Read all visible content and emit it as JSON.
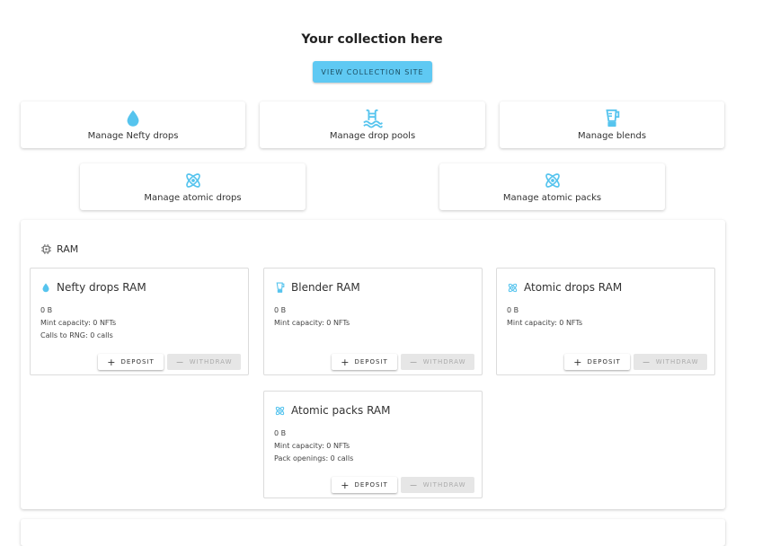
{
  "header": {
    "title": "Your collection here",
    "visit_label": "VIEW COLLECTION SITE"
  },
  "nav": {
    "nefty_drops": {
      "label": "Manage Nefty drops",
      "icon": "water-drop-icon"
    },
    "drop_pools": {
      "label": "Manage drop pools",
      "icon": "pool-icon"
    },
    "blends": {
      "label": "Manage blends",
      "icon": "blender-icon"
    },
    "atomic_drops": {
      "label": "Manage atomic drops",
      "icon": "atom-icon"
    },
    "atomic_packs": {
      "label": "Manage atomic packs",
      "icon": "atom-icon"
    }
  },
  "ram": {
    "title": "RAM",
    "deposit_label": "DEPOSIT",
    "withdraw_label": "WITHDRAW",
    "cards": {
      "nefty": {
        "name": "Nefty drops RAM",
        "bytes": "0 B",
        "mint": "Mint capacity: 0 NFTs",
        "extra": "Calls to RNG: 0 calls"
      },
      "blender": {
        "name": "Blender RAM",
        "bytes": "0 B",
        "mint": "Mint capacity: 0 NFTs"
      },
      "atomic_drops": {
        "name": "Atomic drops RAM",
        "bytes": "0 B",
        "mint": "Mint capacity: 0 NFTs"
      },
      "atomic_packs": {
        "name": "Atomic packs RAM",
        "bytes": "0 B",
        "mint": "Mint capacity: 0 NFTs",
        "extra": "Pack openings: 0 calls"
      }
    }
  },
  "colors": {
    "accent": "#5fc9f3",
    "icon": "#56c4ee"
  }
}
